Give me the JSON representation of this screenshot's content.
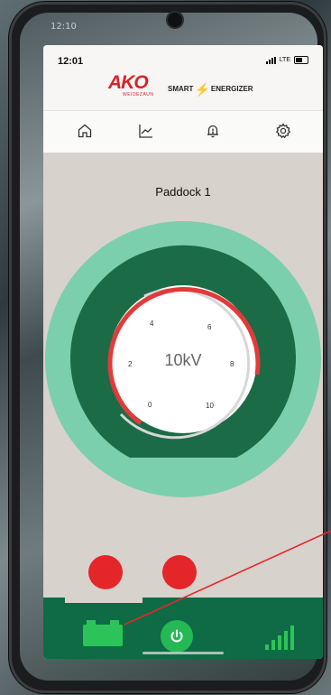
{
  "outer_status": {
    "time": "12:10"
  },
  "status_bar": {
    "time": "12:01",
    "network": "LTE"
  },
  "header": {
    "logo_main": "AKO",
    "logo_sub": "WEIDEZAUN",
    "brand_left": "SMART",
    "brand_right": "ENERGIZER"
  },
  "nav": {
    "items": [
      {
        "icon": "home-icon"
      },
      {
        "icon": "chart-icon"
      },
      {
        "icon": "alarm-bell-icon"
      },
      {
        "icon": "gear-icon"
      }
    ]
  },
  "main": {
    "title": "Paddock 1",
    "gauge": {
      "value_label": "10kV",
      "value": 10,
      "ticks": [
        "0",
        "2",
        "4",
        "6",
        "8",
        "10"
      ],
      "colors": {
        "outer": "#7ccfad",
        "ring": "#1b6b47",
        "needle": "#e23a3a"
      }
    }
  },
  "alerts": {
    "dot_color": "#e4262b",
    "count": 2
  },
  "bottom_bar": {
    "battery_icon": "battery-icon",
    "power_icon": "power-icon",
    "signal_icon": "signal-bars-icon",
    "colors": {
      "bar": "#0e6b45",
      "accent": "#2cc45a"
    }
  }
}
